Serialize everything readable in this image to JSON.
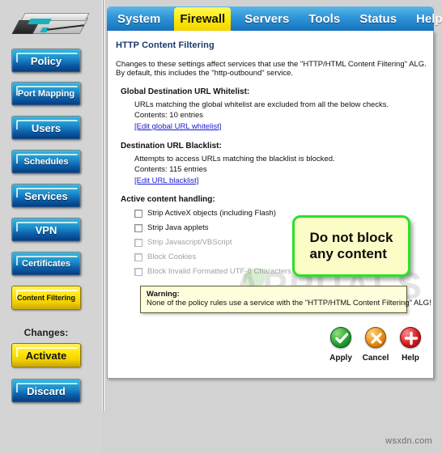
{
  "sidebar": {
    "device_icon": "router-device-image",
    "nav": [
      {
        "label": "Policy",
        "style": "blue"
      },
      {
        "label": "Port Mapping",
        "style": "blue"
      },
      {
        "label": "Users",
        "style": "blue"
      },
      {
        "label": "Schedules",
        "style": "blue"
      },
      {
        "label": "Services",
        "style": "blue"
      },
      {
        "label": "VPN",
        "style": "blue"
      },
      {
        "label": "Certificates",
        "style": "blue"
      },
      {
        "label": "Content Filtering",
        "style": "yellow"
      }
    ],
    "changes_label": "Changes:",
    "changes": [
      {
        "label": "Activate",
        "style": "yellow"
      },
      {
        "label": "Discard",
        "style": "blue"
      }
    ]
  },
  "tabs": [
    {
      "label": "System",
      "active": false
    },
    {
      "label": "Firewall",
      "active": true
    },
    {
      "label": "Servers",
      "active": false
    },
    {
      "label": "Tools",
      "active": false
    },
    {
      "label": "Status",
      "active": false
    },
    {
      "label": "Help",
      "active": false
    }
  ],
  "page": {
    "title": "HTTP Content Filtering",
    "intro_line1": "Changes to these settings affect services that use the \"HTTP/HTML Content Filtering\" ALG.",
    "intro_line2": "By default, this includes the \"http-outbound\" service.",
    "whitelist": {
      "heading": "Global Destination URL Whitelist:",
      "description": "URLs matching the global whitelist are excluded from all the below checks.",
      "contents": "Contents: 10 entries",
      "link": "[Edit global URL whitelist]"
    },
    "blacklist": {
      "heading": "Destination URL Blacklist:",
      "description": "Attempts to access URLs matching the blacklist is blocked.",
      "contents": "Contents: 115 entries",
      "link": "[Edit URL blacklist]"
    },
    "active_content": {
      "heading": "Active content handling:",
      "items": [
        {
          "label": "Strip ActiveX objects (including Flash)",
          "checked": false,
          "disabled": false
        },
        {
          "label": "Strip Java applets",
          "checked": false,
          "disabled": false
        },
        {
          "label": "Strip Javascript/VBScript",
          "checked": false,
          "disabled": true
        },
        {
          "label": "Block Cookies",
          "checked": false,
          "disabled": true
        },
        {
          "label": "Block Invalid Formatted UTF-8 Characters",
          "checked": false,
          "disabled": true
        }
      ]
    },
    "callout": "Do not block\nany content",
    "warning": {
      "title": "Warning:",
      "body": "None of the policy rules use a service with the \"HTTP/HTML Content Filtering\" ALG!"
    },
    "actions": [
      {
        "label": "Apply",
        "icon": "check-circle-icon"
      },
      {
        "label": "Cancel",
        "icon": "x-circle-icon"
      },
      {
        "label": "Help",
        "icon": "plus-circle-icon"
      }
    ]
  },
  "watermarks": {
    "overlay": "APPUALS",
    "site": "wsxdn.com"
  },
  "colors": {
    "tab_active": "#ffe900",
    "tab_bar": "#2f94d8",
    "nav_blue": "#1f8ecb",
    "nav_yellow": "#ffe500",
    "callout_border": "#2ae02a",
    "callout_bg": "#fcfcc6",
    "link": "#1a1ad0",
    "title": "#1a3a6b"
  }
}
